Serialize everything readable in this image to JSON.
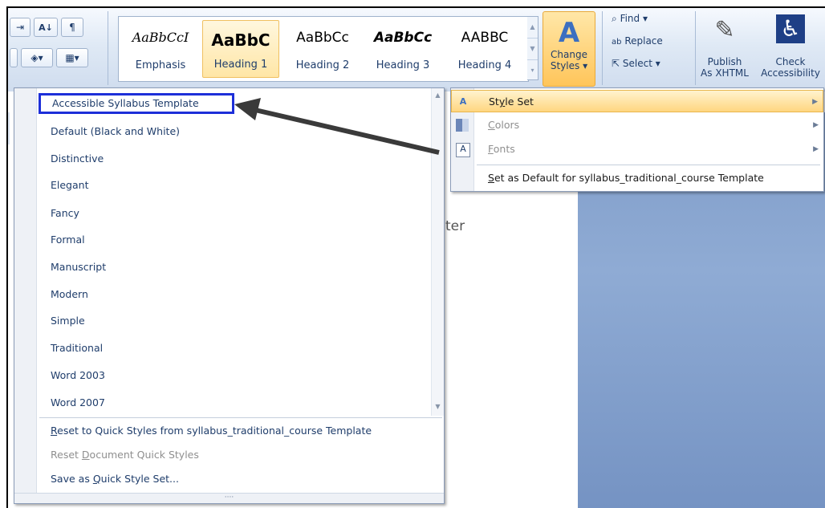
{
  "ribbon": {
    "quick_styles": [
      {
        "sample": "AaBbCcI",
        "label": "Emphasis"
      },
      {
        "sample": "AaBbC",
        "label": "Heading 1"
      },
      {
        "sample": "AaBbCc",
        "label": "Heading 2"
      },
      {
        "sample": "AaBbCc",
        "label": "Heading 3"
      },
      {
        "sample": "AABBC",
        "label": "Heading 4"
      }
    ],
    "change_styles": {
      "line1": "Change",
      "line2": "Styles"
    },
    "find": "Find",
    "replace": "Replace",
    "select": "Select",
    "publish": {
      "line1": "Publish",
      "line2": "As XHTML"
    },
    "check": {
      "line1": "Check",
      "line2": "Accessibility"
    }
  },
  "menu": {
    "items": [
      "Accessible Syllabus Template",
      "Default (Black and White)",
      "Distinctive",
      "Elegant",
      "Fancy",
      "Formal",
      "Manuscript",
      "Modern",
      "Simple",
      "Traditional",
      "Word 2003",
      "Word 2007"
    ],
    "reset_quick_styles": {
      "pre": "",
      "u": "R",
      "post": "eset to Quick Styles from syllabus_traditional_course Template"
    },
    "reset_document": {
      "pre": "Reset ",
      "u": "D",
      "post": "ocument Quick Styles"
    },
    "save_set": {
      "pre": "Save as ",
      "u": "Q",
      "post": "uick Style Set..."
    }
  },
  "submenu": {
    "style_set": {
      "pre": "St",
      "u": "y",
      "post": "le Set"
    },
    "colors": {
      "pre": "",
      "u": "C",
      "post": "olors"
    },
    "fonts": {
      "pre": "",
      "u": "F",
      "post": "onts"
    },
    "set_default": {
      "pre": "",
      "u": "S",
      "post": "et as Default for syllabus_traditional_course Template"
    }
  },
  "doc_fragment": "ter",
  "colors": {
    "highlight_border": "#1d2fd9",
    "menu_text": "#1f3d6b",
    "active_bg": "#ffd680"
  }
}
